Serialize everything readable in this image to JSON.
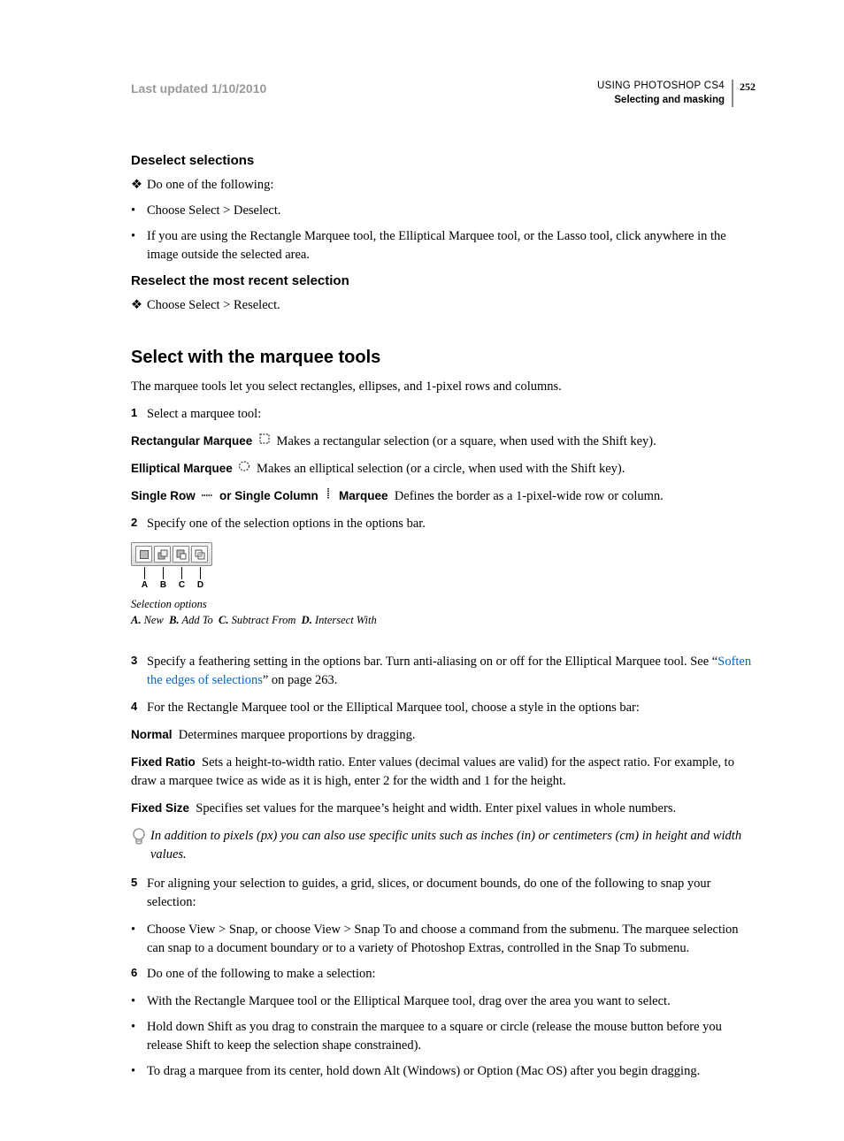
{
  "header": {
    "updated": "Last updated 1/10/2010",
    "product": "USING PHOTOSHOP CS4",
    "chapter": "Selecting and masking",
    "page": "252"
  },
  "sections": {
    "deselect": {
      "title": "Deselect selections",
      "lead": "Do one of the following:",
      "items": [
        "Choose Select > Deselect.",
        "If you are using the Rectangle Marquee tool, the Elliptical Marquee tool, or the Lasso tool, click anywhere in the image outside the selected area."
      ]
    },
    "reselect": {
      "title": "Reselect the most recent selection",
      "lead": "Choose Select > Reselect."
    },
    "marquee": {
      "title": "Select with the marquee tools",
      "intro": "The marquee tools let you select rectangles, ellipses, and 1-pixel rows and columns.",
      "step1": "Select a marquee tool:",
      "tools": {
        "rect_label": "Rectangular Marquee",
        "rect_desc": "Makes a rectangular selection (or a square, when used with the Shift key).",
        "ellip_label": "Elliptical Marquee",
        "ellip_desc": "Makes an elliptical selection (or a circle, when used with the Shift key).",
        "rowcol_label_a": "Single Row",
        "rowcol_or": "or Single Column",
        "rowcol_label_b": "Marquee",
        "rowcol_desc": "Defines the border as a 1-pixel-wide row or column."
      },
      "step2": "Specify one of the selection options in the options bar.",
      "options_caption": "Selection options",
      "options_key": {
        "A": "New",
        "B": "Add To",
        "C": "Subtract From",
        "D": "Intersect With"
      },
      "step3_a": "Specify a feathering setting in the options bar. Turn anti-aliasing on or off for the Elliptical Marquee tool. See “",
      "step3_link": "Soften the edges of selections",
      "step3_b": "” on page 263.",
      "step4": "For the Rectangle Marquee tool or the Elliptical Marquee tool, choose a style in the options bar:",
      "styles": {
        "normal_label": "Normal",
        "normal_desc": "Determines marquee proportions by dragging.",
        "ratio_label": "Fixed Ratio",
        "ratio_desc": "Sets a height-to-width ratio. Enter values (decimal values are valid) for the aspect ratio. For example, to draw a marquee twice as wide as it is high, enter 2 for the width and 1 for the height.",
        "size_label": "Fixed Size",
        "size_desc": "Specifies set values for the marquee’s height and width. Enter pixel values in whole numbers."
      },
      "tip": "In addition to pixels (px) you can also use specific units such as inches (in) or centimeters (cm) in height and width values.",
      "step5": "For aligning your selection to guides, a grid, slices, or document bounds, do one of the following to snap your selection:",
      "step5_items": [
        "Choose View > Snap, or choose View > Snap To and choose a command from the submenu. The marquee selection can snap to a document boundary or to a variety of Photoshop Extras, controlled in the Snap To submenu."
      ],
      "step6": "Do one of the following to make a selection:",
      "step6_items": [
        "With the Rectangle Marquee tool or the Elliptical Marquee tool, drag over the area you want to select.",
        "Hold down Shift as you drag to constrain the marquee to a square or circle (release the mouse button before you release Shift to keep the selection shape constrained).",
        "To drag a marquee from its center, hold down Alt (Windows) or Option (Mac OS) after you begin dragging."
      ]
    }
  }
}
